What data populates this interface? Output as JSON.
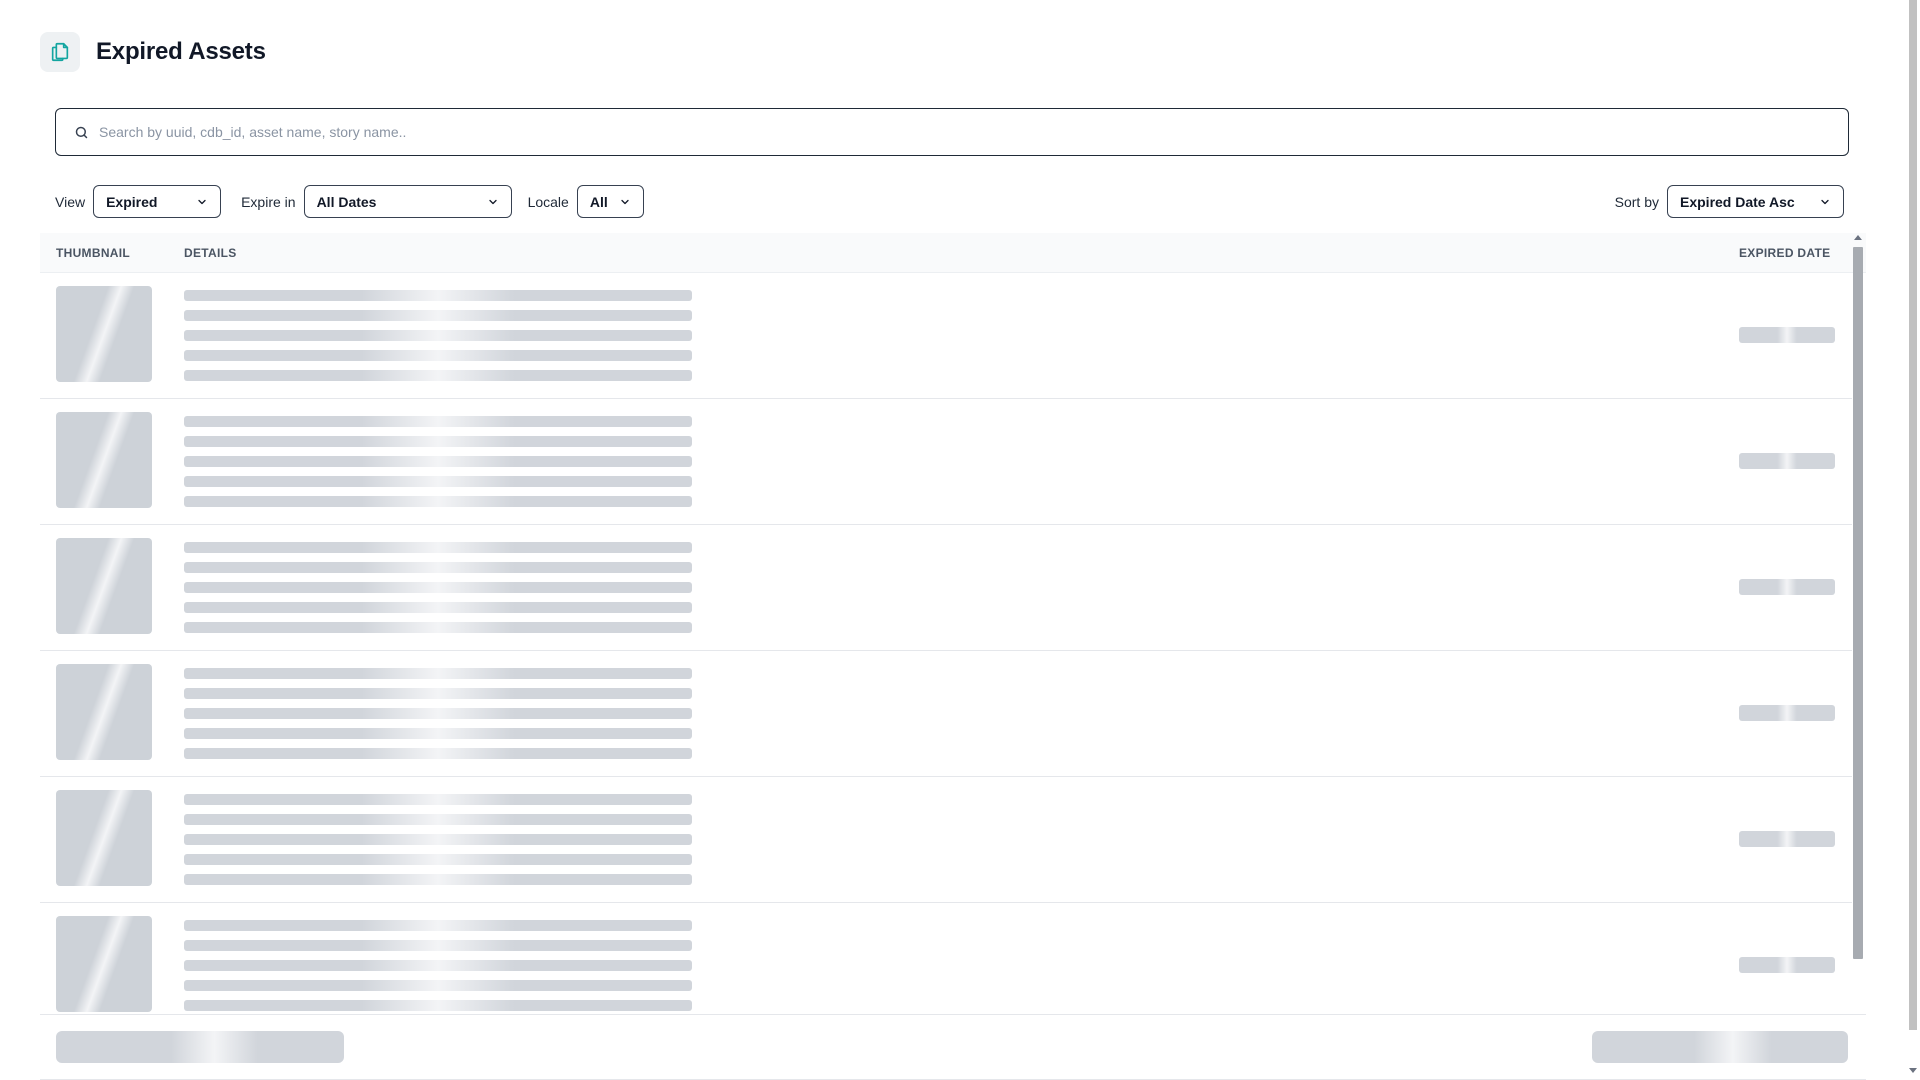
{
  "header": {
    "title": "Expired Assets",
    "icon": "copy-document-icon",
    "accent": "#12a5a0"
  },
  "search": {
    "placeholder": "Search by uuid, cdb_id, asset name, story name..",
    "value": ""
  },
  "filters": {
    "view": {
      "label": "View",
      "selected": "Expired"
    },
    "expire_in": {
      "label": "Expire in",
      "selected": "All Dates"
    },
    "locale": {
      "label": "Locale",
      "selected": "All"
    }
  },
  "sort": {
    "label": "Sort by",
    "selected": "Expired Date Asc"
  },
  "table": {
    "columns": [
      "THUMBNAIL",
      "DETAILS",
      "EXPIRED DATE"
    ],
    "loading": true,
    "skeleton_row_count": 6,
    "detail_lines_per_row": 5
  },
  "footer": {
    "loading": true
  }
}
